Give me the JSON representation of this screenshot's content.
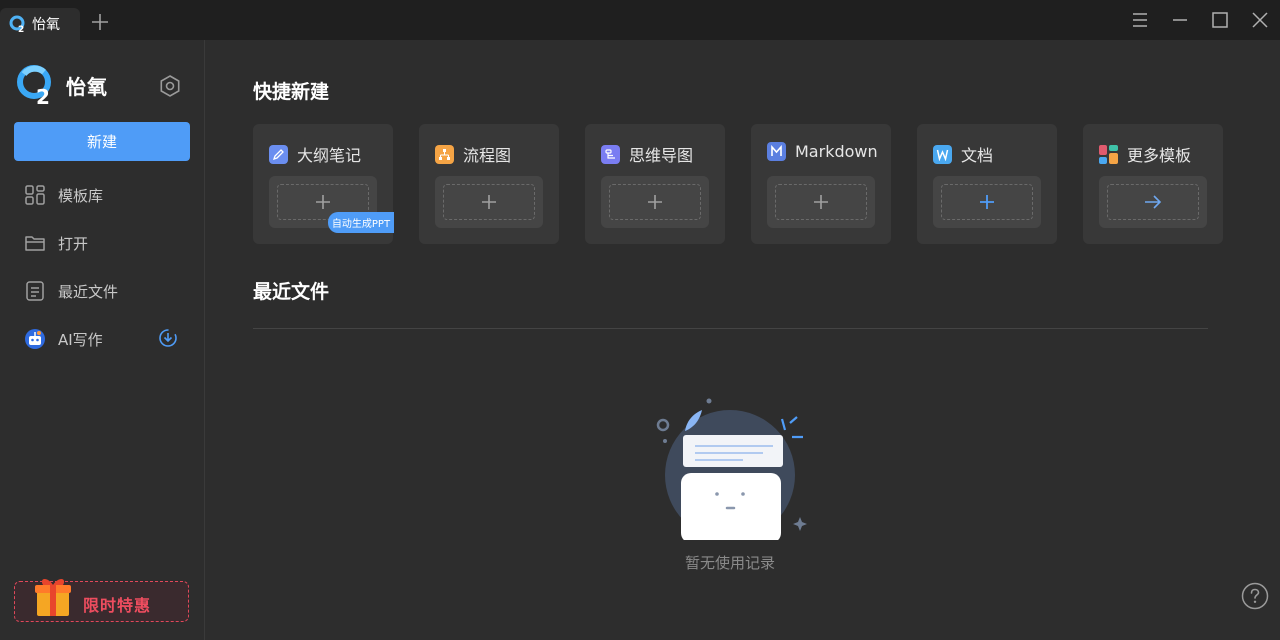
{
  "titlebar": {
    "tab_title": "怡氧",
    "new_tab_icon": "plus-icon",
    "controls": [
      "menu-icon",
      "minimize-icon",
      "maximize-icon",
      "close-icon"
    ]
  },
  "sidebar": {
    "brand_name": "怡氧",
    "new_button_label": "新建",
    "items": [
      {
        "label": "模板库",
        "icon": "template-grid-icon"
      },
      {
        "label": "打开",
        "icon": "folder-icon"
      },
      {
        "label": "最近文件",
        "icon": "document-icon"
      },
      {
        "label": "AI写作",
        "icon": "ai-robot-icon"
      }
    ],
    "promo_label": "限时特惠"
  },
  "main": {
    "quick_create_title": "快捷新建",
    "cards": [
      {
        "label": "大纲笔记",
        "icon": "outline-note-icon",
        "color": "#6b8ef0",
        "action": "plus"
      },
      {
        "label": "流程图",
        "icon": "flowchart-icon",
        "color": "#f5a445",
        "action": "plus"
      },
      {
        "label": "思维导图",
        "icon": "mindmap-icon",
        "color": "#7a7df2",
        "action": "plus"
      },
      {
        "label": "Markdown",
        "icon": "markdown-icon",
        "color": "#5b7fe0",
        "action": "plus"
      },
      {
        "label": "文档",
        "icon": "word-doc-icon",
        "color": "#4aa8f0",
        "action": "plus"
      },
      {
        "label": "更多模板",
        "icon": "more-templates-icon",
        "color": "#e05b6e",
        "action": "arrow"
      }
    ],
    "ppt_badge": "自动生成PPT",
    "recent_title": "最近文件",
    "empty_text": "暂无使用记录"
  },
  "colors": {
    "accent": "#4f9cf7",
    "promo": "#ee4d5f",
    "background": "#2d2d2d",
    "card": "#383838"
  }
}
